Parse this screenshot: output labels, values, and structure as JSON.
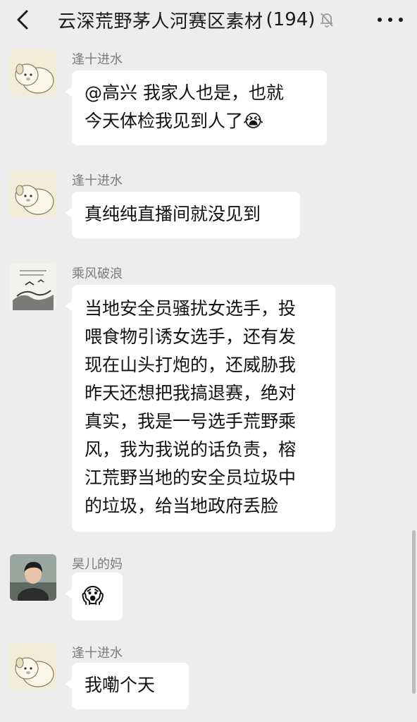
{
  "header": {
    "title": "云深荒野茅人河赛区素材",
    "member_count": "(194)",
    "back_icon": "chevron-left-icon",
    "mute_icon": "bell-off-icon",
    "more_icon": "more-dots-icon"
  },
  "messages": [
    {
      "sender": "逢十进水",
      "lines": [
        "@高兴 我家人也是，也就",
        "今天体检我见到人了😭"
      ]
    },
    {
      "sender": "逢十进水",
      "lines": [
        "真纯纯直播间就没见到"
      ]
    },
    {
      "sender": "乘风破浪",
      "lines": [
        "当地安全员骚扰女选手，投",
        "喂食物引诱女选手，还有发",
        "现在山头打炮的，还威胁我",
        "昨天还想把我搞退赛，绝对",
        "真实，我是一号选手荒野乘",
        "风，我为我说的话负责，榕",
        "江荒野当地的安全员垃圾中",
        "的垃圾，给当地政府丢脸"
      ]
    },
    {
      "sender": "昊儿的妈",
      "lines": [
        "😱"
      ]
    },
    {
      "sender": "逢十进水",
      "lines": [
        "我嘞个天"
      ]
    }
  ],
  "colors": {
    "background": "#ededed",
    "bubble": "#ffffff",
    "sender_name": "#7c7c7c"
  }
}
